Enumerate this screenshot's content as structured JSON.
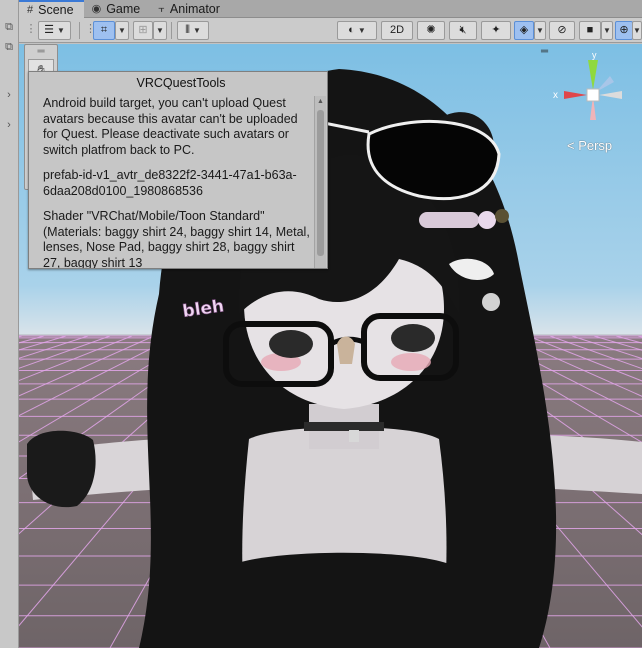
{
  "tabs": [
    {
      "label": "Scene",
      "icon": "hash-icon",
      "active": true
    },
    {
      "label": "Game",
      "icon": "gamepad-icon",
      "active": false
    },
    {
      "label": "Animator",
      "icon": "animator-icon",
      "active": false
    }
  ],
  "toolbar": {
    "view_2d_label": "2D"
  },
  "gizmo": {
    "projection_label": "< Persp",
    "axis_x": "x",
    "axis_y": "y"
  },
  "dialog": {
    "title": "VRCQuestTools",
    "paragraphs": [
      "Android build target, you can't upload Quest avatars because this avatar can't be uploaded for Quest. Please deactivate such avatars or switch platfrom back to PC.",
      "prefab-id-v1_avtr_de8322f2-3441-47a1-b63a-6daa208d0100_1980868536",
      "Shader \"VRChat/Mobile/Toon Standard\" (Materials: baggy shirt 24, baggy shirt 14, Metal, lenses, Nose Pad, baggy shirt 28, baggy shirt 27, baggy shirt 13"
    ]
  },
  "colors": {
    "accent": "#3a79d6",
    "selected_tool": "#9ec0f0",
    "sky_top": "#7dbfe4",
    "ground": "#746a6d",
    "grid_lines": "#e3a6ea",
    "gizmo_x": "#e0474c",
    "gizmo_y": "#8fd93f"
  },
  "avatar": {
    "hair_clip_text": "bleh"
  }
}
